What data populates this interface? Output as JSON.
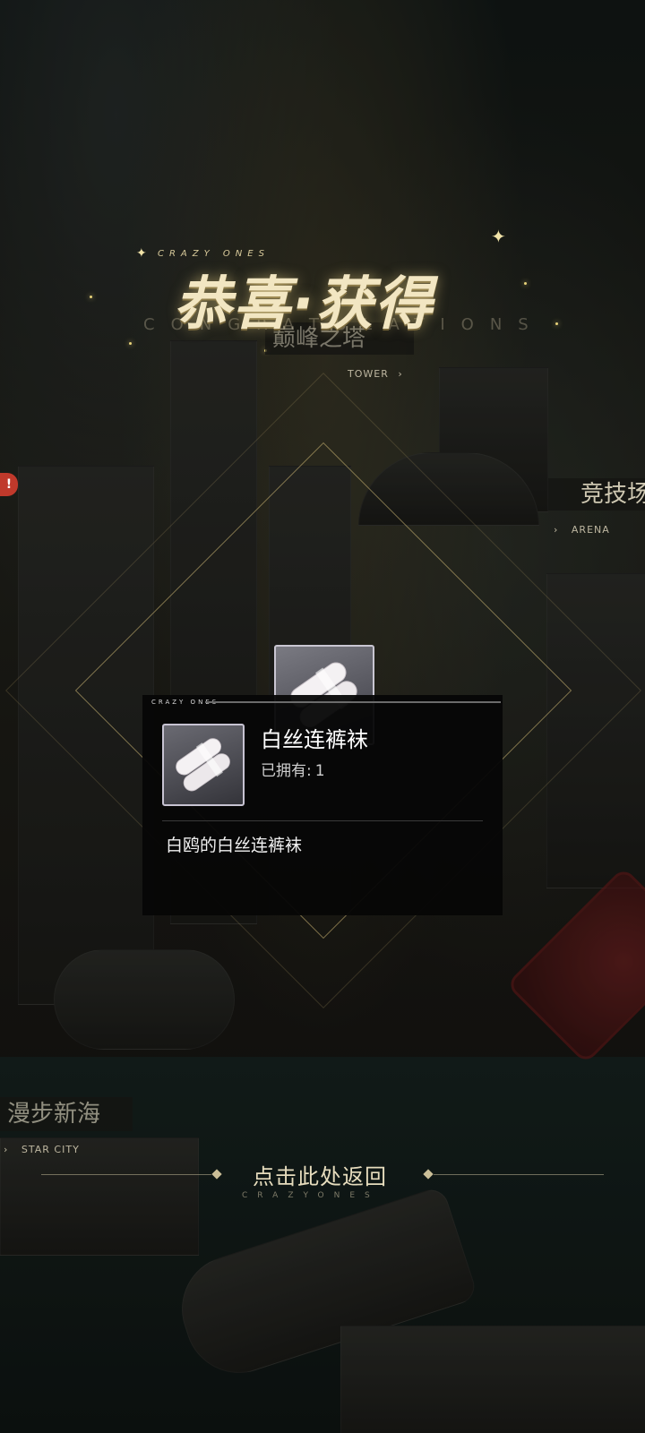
{
  "header": {
    "brand_top": "CRAZY ONES",
    "title": "恭喜·获得",
    "subtitle": "CONGRATULATIONS"
  },
  "map_labels": {
    "tower": {
      "name": "巅峰之塔",
      "sub": "TOWER"
    },
    "arena": {
      "name": "竞技场",
      "sub": "ARENA"
    },
    "star_city": {
      "name": "漫步新海",
      "sub": "STAR CITY"
    }
  },
  "reward_card": {
    "brand": "CRAZY ONES",
    "item_name": "白丝连裤袜",
    "owned_label": "已拥有:",
    "owned_count": "1",
    "description": "白鸥的白丝连裤袜",
    "icon": "white-pantyhose-item-icon"
  },
  "return_button": {
    "label": "点击此处返回",
    "sub": "CRAZYONES"
  },
  "notification_badge": "!",
  "colors": {
    "gold_accent": "#d6be78",
    "card_bg": "#060606",
    "text_primary": "#ffffff",
    "badge_red": "#c0392b"
  }
}
